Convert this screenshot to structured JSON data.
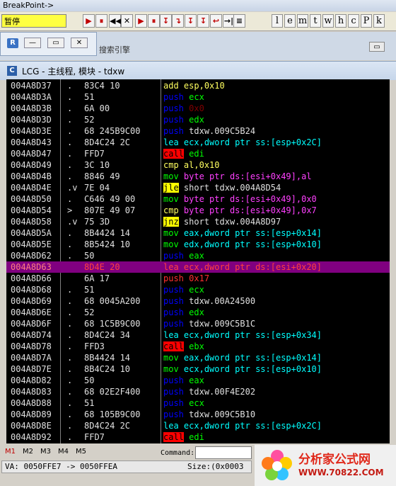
{
  "window": {
    "title": "BreakPoint->"
  },
  "toolbar": {
    "status_label": "暂停",
    "buttons": [
      "▶",
      "⏸",
      "◀◀",
      "✕",
      "▶",
      "⏸",
      "↧",
      "↴",
      "↧",
      "↧",
      "↩",
      "→|",
      "≡"
    ],
    "letters": [
      "l",
      "e",
      "m",
      "t",
      "w",
      "h",
      "c",
      "P",
      "k"
    ]
  },
  "subwindow": {
    "title": "搜索引擎"
  },
  "code_window": {
    "title": "LCG - 主线程, 模块 - tdxw",
    "icon": "C"
  },
  "rows": [
    {
      "addr": "004A8D37",
      "mark": ".",
      "hex": "83C4 10",
      "op": "add",
      "opn": "esp,0x10",
      "cls": "c-add",
      "ocls": "opn-yel"
    },
    {
      "addr": "004A8D3A",
      "mark": ".",
      "hex": "51",
      "op": "push",
      "opn": "ecx",
      "cls": "c-push",
      "ocls": "opn-green"
    },
    {
      "addr": "004A8D3B",
      "mark": ".",
      "hex": "6A 00",
      "op": "push",
      "opn": "0x0",
      "cls": "c-push",
      "ocls": "opn-dim"
    },
    {
      "addr": "004A8D3D",
      "mark": ".",
      "hex": "52",
      "op": "push",
      "opn": "edx",
      "cls": "c-push",
      "ocls": "opn-green"
    },
    {
      "addr": "004A8D3E",
      "mark": ".",
      "hex": "68 245B9C00",
      "op": "push",
      "opn": "tdxw.009C5B24",
      "cls": "c-push",
      "ocls": "opn-white"
    },
    {
      "addr": "004A8D43",
      "mark": ".",
      "hex": "8D4C24 2C",
      "op": "lea",
      "opn": "ecx,dword ptr ss:[esp+0x2C]",
      "cls": "c-lea",
      "ocls": "opn-cyan"
    },
    {
      "addr": "004A8D47",
      "mark": ".",
      "hex": "FFD7",
      "op": "call",
      "opn": "edi",
      "cls": "c-call",
      "ocls": "opn-green"
    },
    {
      "addr": "004A8D49",
      "mark": ".",
      "hex": "3C 10",
      "op": "cmp",
      "opn": "al,0x10",
      "cls": "c-cmp",
      "ocls": "opn-yel"
    },
    {
      "addr": "004A8D4B",
      "mark": ".",
      "hex": "8846 49",
      "op": "mov",
      "opn": "byte ptr ds:[esi+0x49],al",
      "cls": "c-mov",
      "ocls": "opn-mag"
    },
    {
      "addr": "004A8D4E",
      "mark": ".v",
      "hex": "7E 04",
      "op": "jle",
      "opn": "short tdxw.004A8D54",
      "cls": "c-jcc",
      "ocls": "opn-white"
    },
    {
      "addr": "004A8D50",
      "mark": ".",
      "hex": "C646 49 00",
      "op": "mov",
      "opn": "byte ptr ds:[esi+0x49],0x0",
      "cls": "c-mov",
      "ocls": "opn-mag"
    },
    {
      "addr": "004A8D54",
      "mark": ">",
      "hex": "807E 49 07",
      "op": "cmp",
      "opn": "byte ptr ds:[esi+0x49],0x7",
      "cls": "c-cmp",
      "ocls": "opn-mag"
    },
    {
      "addr": "004A8D58",
      "mark": ".v",
      "hex": "75 3D",
      "op": "jnz",
      "opn": "short tdxw.004A8D97",
      "cls": "c-jcc",
      "ocls": "opn-white"
    },
    {
      "addr": "004A8D5A",
      "mark": ".",
      "hex": "8B4424 14",
      "op": "mov",
      "opn": "eax,dword ptr ss:[esp+0x14]",
      "cls": "c-mov",
      "ocls": "opn-cyan"
    },
    {
      "addr": "004A8D5E",
      "mark": ".",
      "hex": "8B5424 10",
      "op": "mov",
      "opn": "edx,dword ptr ss:[esp+0x10]",
      "cls": "c-mov",
      "ocls": "opn-cyan"
    },
    {
      "addr": "004A8D62",
      "mark": ".",
      "hex": "50",
      "op": "push",
      "opn": "eax",
      "cls": "c-push",
      "ocls": "opn-green"
    },
    {
      "addr": "004A8D63",
      "mark": "",
      "hex": "8D4E 20",
      "op": "lea",
      "opn": "ecx,dword ptr ds:[esi+0x20]",
      "cls": "c-lea-hl",
      "ocls": "c-lea-hl",
      "hl": true
    },
    {
      "addr": "004A8D66",
      "mark": "",
      "hex": "6A 17",
      "op": "push",
      "opn": "0x17",
      "cls": "c-push-red",
      "ocls": "c-push-red"
    },
    {
      "addr": "004A8D68",
      "mark": ".",
      "hex": "51",
      "op": "push",
      "opn": "ecx",
      "cls": "c-push",
      "ocls": "opn-green"
    },
    {
      "addr": "004A8D69",
      "mark": ".",
      "hex": "68 0045A200",
      "op": "push",
      "opn": "tdxw.00A24500",
      "cls": "c-push",
      "ocls": "opn-white"
    },
    {
      "addr": "004A8D6E",
      "mark": ".",
      "hex": "52",
      "op": "push",
      "opn": "edx",
      "cls": "c-push",
      "ocls": "opn-green"
    },
    {
      "addr": "004A8D6F",
      "mark": ".",
      "hex": "68 1C5B9C00",
      "op": "push",
      "opn": "tdxw.009C5B1C",
      "cls": "c-push",
      "ocls": "opn-white"
    },
    {
      "addr": "004A8D74",
      "mark": ".",
      "hex": "8D4C24 34",
      "op": "lea",
      "opn": "ecx,dword ptr ss:[esp+0x34]",
      "cls": "c-lea",
      "ocls": "opn-cyan"
    },
    {
      "addr": "004A8D78",
      "mark": ".",
      "hex": "FFD3",
      "op": "call",
      "opn": "ebx",
      "cls": "c-call",
      "ocls": "opn-green"
    },
    {
      "addr": "004A8D7A",
      "mark": ".",
      "hex": "8B4424 14",
      "op": "mov",
      "opn": "eax,dword ptr ss:[esp+0x14]",
      "cls": "c-mov",
      "ocls": "opn-cyan"
    },
    {
      "addr": "004A8D7E",
      "mark": ".",
      "hex": "8B4C24 10",
      "op": "mov",
      "opn": "ecx,dword ptr ss:[esp+0x10]",
      "cls": "c-mov",
      "ocls": "opn-cyan"
    },
    {
      "addr": "004A8D82",
      "mark": ".",
      "hex": "50",
      "op": "push",
      "opn": "eax",
      "cls": "c-push",
      "ocls": "opn-green"
    },
    {
      "addr": "004A8D83",
      "mark": ".",
      "hex": "68 02E2F400",
      "op": "push",
      "opn": "tdxw.00F4E202",
      "cls": "c-push",
      "ocls": "opn-white"
    },
    {
      "addr": "004A8D88",
      "mark": ".",
      "hex": "51",
      "op": "push",
      "opn": "ecx",
      "cls": "c-push",
      "ocls": "opn-green"
    },
    {
      "addr": "004A8D89",
      "mark": ".",
      "hex": "68 105B9C00",
      "op": "push",
      "opn": "tdxw.009C5B10",
      "cls": "c-push",
      "ocls": "opn-white"
    },
    {
      "addr": "004A8D8E",
      "mark": ".",
      "hex": "8D4C24 2C",
      "op": "lea",
      "opn": "ecx,dword ptr ss:[esp+0x2C]",
      "cls": "c-lea",
      "ocls": "opn-cyan"
    },
    {
      "addr": "004A8D92",
      "mark": ".",
      "hex": "FFD7",
      "op": "call",
      "opn": "edi",
      "cls": "c-call",
      "ocls": "opn-green"
    }
  ],
  "bottom": {
    "tabs": [
      "M1",
      "M2",
      "M3",
      "M4",
      "M5"
    ],
    "command_label": "Command:",
    "va_text": "VA: 0050FFE7 -> 0050FFEA",
    "size_text": "Size:(0x0003"
  },
  "logo": {
    "name": "分析家公式网",
    "url": "WWW.70822.COM"
  },
  "colors": {
    "code_bg": "#000000",
    "highlight_row": "#800080",
    "status_yellow": "#ffff40"
  }
}
